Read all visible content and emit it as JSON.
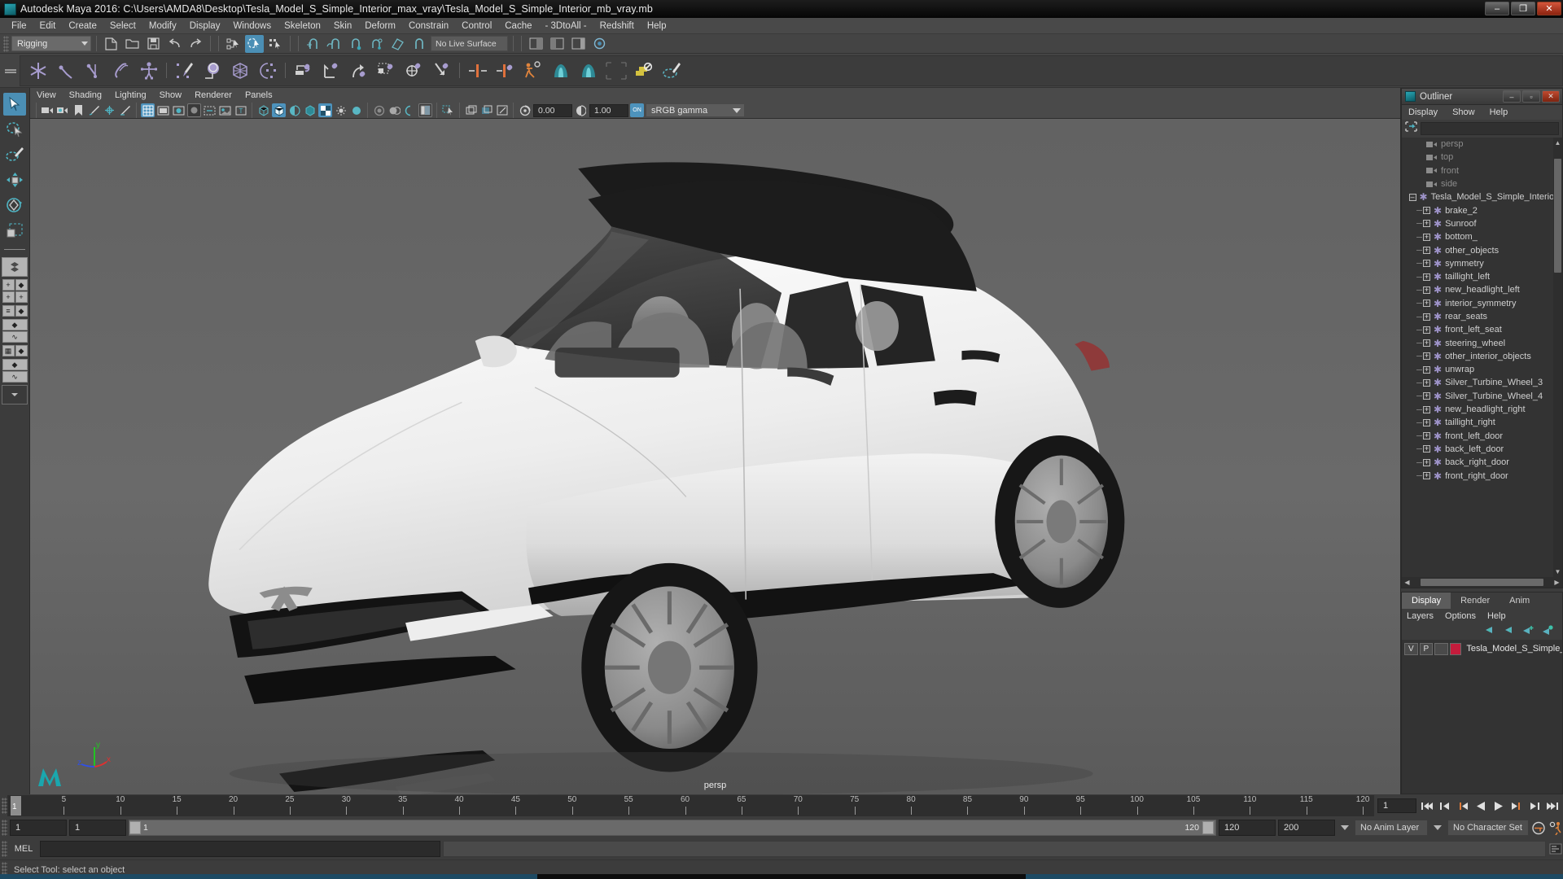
{
  "window": {
    "title": "Autodesk Maya 2016: C:\\Users\\AMDA8\\Desktop\\Tesla_Model_S_Simple_Interior_max_vray\\Tesla_Model_S_Simple_Interior_mb_vray.mb",
    "minimize": "–",
    "restore": "❐",
    "close": "✕"
  },
  "menubar": {
    "items": [
      "File",
      "Edit",
      "Create",
      "Select",
      "Modify",
      "Display",
      "Windows",
      "Skeleton",
      "Skin",
      "Deform",
      "Constrain",
      "Control",
      "Cache",
      "- 3DtoAll -",
      "Redshift",
      "Help"
    ]
  },
  "statusline": {
    "menuset": "Rigging",
    "live_surface": "No Live Surface"
  },
  "viewport_menu": {
    "items": [
      "View",
      "Shading",
      "Lighting",
      "Show",
      "Renderer",
      "Panels"
    ]
  },
  "viewport_toolbar": {
    "exposure": "0.00",
    "gamma": "1.00",
    "view_transform": "sRGB gamma",
    "cm_toggle": "ON"
  },
  "viewport": {
    "camera_label": "persp",
    "axis": {
      "x": "x",
      "y": "y",
      "z": "z"
    }
  },
  "outliner": {
    "title": "Outliner",
    "menus": [
      "Display",
      "Show",
      "Help"
    ],
    "search_value": "",
    "cameras": [
      "persp",
      "top",
      "front",
      "side"
    ],
    "root": {
      "label": "Tesla_Model_S_Simple_Interior_",
      "expander": "–"
    },
    "children": [
      "brake_2",
      "Sunroof",
      "bottom_",
      "other_objects",
      "symmetry",
      "taillight_left",
      "new_headlight_left",
      "interior_symmetry",
      "rear_seats",
      "front_left_seat",
      "steering_wheel",
      "other_interior_objects",
      "unwrap",
      "Silver_Turbine_Wheel_3",
      "Silver_Turbine_Wheel_4",
      "new_headlight_right",
      "taillight_right",
      "front_left_door",
      "back_left_door",
      "back_right_door",
      "front_right_door"
    ],
    "child_expander": "+"
  },
  "layer_editor": {
    "tabs": [
      "Display",
      "Render",
      "Anim"
    ],
    "active_tab": "Display",
    "menus": [
      "Layers",
      "Options",
      "Help"
    ],
    "rows": [
      {
        "visibility": "V",
        "playback": "P",
        "type": "",
        "color": "#c41c3c",
        "name": "Tesla_Model_S_Simple_"
      }
    ]
  },
  "timeline": {
    "ticks": [
      5,
      10,
      15,
      20,
      25,
      30,
      35,
      40,
      45,
      50,
      55,
      60,
      65,
      70,
      75,
      80,
      85,
      90,
      95,
      100,
      105,
      110,
      115,
      120
    ],
    "current_frame": "1",
    "current_frame_field": "1"
  },
  "range_slider": {
    "start": "1",
    "anim_start": "1",
    "range_label": "1",
    "range_end_label": "120",
    "anim_end": "120",
    "end": "200",
    "anim_layer": "No Anim Layer",
    "character_set": "No Character Set"
  },
  "command_line": {
    "label": "MEL",
    "input": "",
    "output": ""
  },
  "help_line": {
    "text": "Select Tool: select an object"
  },
  "colors": {
    "accent_blue": "#4b8fb5",
    "node_purple": "#9e93c9",
    "layer_red": "#c41c3c",
    "panel_bg": "#3c3c3c",
    "tree_bg": "#333333",
    "orange": "#e07b39"
  }
}
